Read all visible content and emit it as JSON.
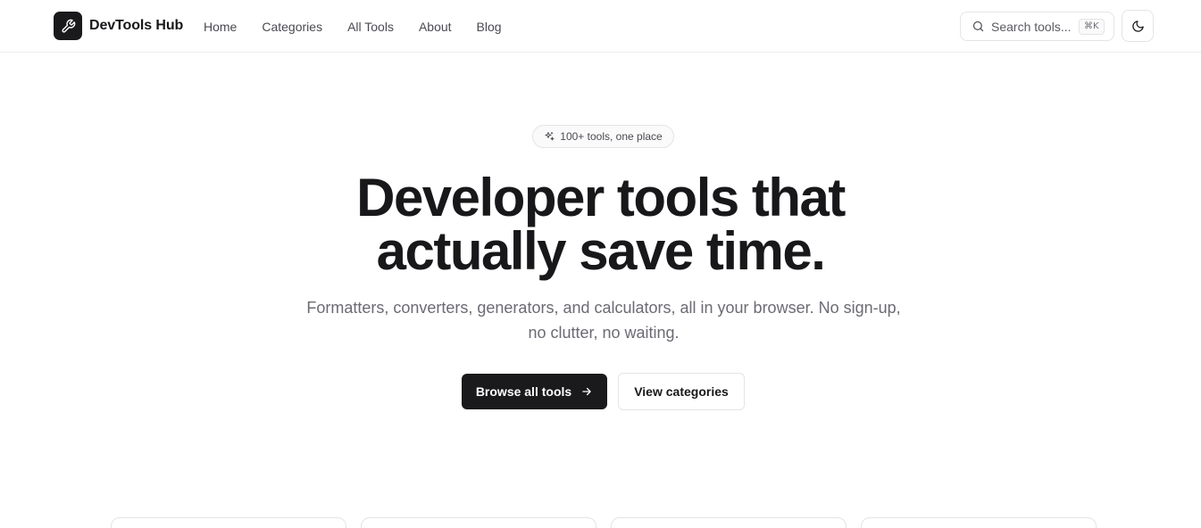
{
  "header": {
    "brand": "DevTools Hub",
    "nav": [
      "Home",
      "Categories",
      "All Tools",
      "About",
      "Blog"
    ],
    "search_placeholder": "Search tools...",
    "search_shortcut": "⌘K"
  },
  "hero": {
    "badge": "100+ tools, one place",
    "headline_line1": "Developer tools that",
    "headline_line2": "actually save time.",
    "subtitle_line1": "Formatters, converters, generators, and calculators, all in your browser. No sign-up,",
    "subtitle_line2": "no clutter, no waiting.",
    "primary_cta": "Browse all tools",
    "secondary_cta": "View categories"
  },
  "icons": {
    "logo": "wrench-icon",
    "search": "search-icon",
    "theme": "moon-icon",
    "badge": "sparkles-icon",
    "cta": "arrow-right-icon"
  },
  "colors": {
    "primary": "#1a1a1c",
    "border": "#e4e4e7",
    "muted_text": "#6b6b73"
  }
}
